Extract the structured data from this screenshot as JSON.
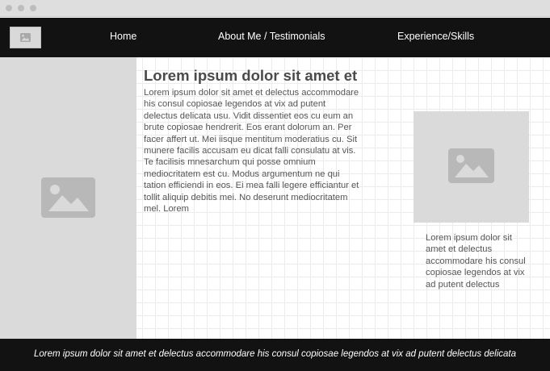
{
  "window": {
    "controls": [
      "close-dot",
      "minimize-dot",
      "maximize-dot"
    ]
  },
  "navbar": {
    "logo_icon": "image-placeholder-icon",
    "links": [
      {
        "label": "Home"
      },
      {
        "label": "About Me / Testimonials"
      },
      {
        "label": "Experience/Skills"
      }
    ]
  },
  "main": {
    "sidebar_image_icon": "image-placeholder-icon",
    "heading": "Lorem ipsum dolor sit amet et",
    "body": "Lorem ipsum dolor sit amet et delectus accommodare his consul copiosae legendos at vix ad putent delectus delicata usu. Vidit dissentiet eos cu eum an brute copiosae hendrerit. Eos erant dolorum an. Per facer affert ut. Mei iisque mentitum moderatius cu. Sit munere facilis accusam eu dicat falli consulatu at vis. Te facilisis mnesarchum qui posse omnium mediocritatem est cu. Modus argumentum ne qui tation efficiendi in eos. Ei mea falli legere efficiantur et tollit aliquip debitis mei. No deserunt mediocritatem mel. Lorem",
    "side_image_icon": "image-placeholder-icon",
    "caption": "Lorem ipsum dolor sit amet et delectus accommodare his consul copiosae legendos at vix ad putent delectus"
  },
  "footer": {
    "text": "Lorem ipsum dolor sit amet et delectus accommodare his consul copiosae legendos at vix ad putent delectus delicata"
  },
  "colors": {
    "bar_background": "#121212",
    "placeholder_background": "#dadada",
    "placeholder_icon": "#b8b8b8",
    "heading_text": "#4a4a4a",
    "body_text": "#555555"
  }
}
